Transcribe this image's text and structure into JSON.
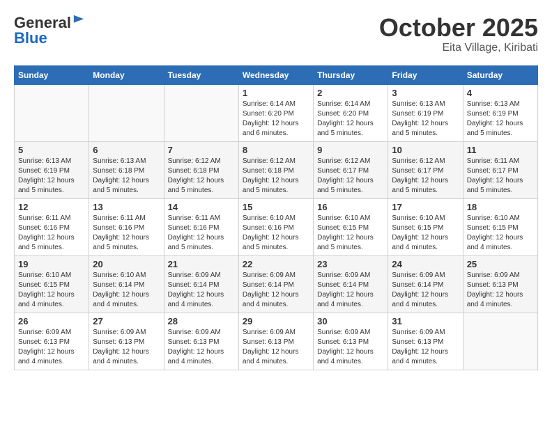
{
  "header": {
    "logo_line1": "General",
    "logo_line2": "Blue",
    "month": "October 2025",
    "location": "Eita Village, Kiribati"
  },
  "weekdays": [
    "Sunday",
    "Monday",
    "Tuesday",
    "Wednesday",
    "Thursday",
    "Friday",
    "Saturday"
  ],
  "weeks": [
    [
      {
        "day": "",
        "info": ""
      },
      {
        "day": "",
        "info": ""
      },
      {
        "day": "",
        "info": ""
      },
      {
        "day": "1",
        "info": "Sunrise: 6:14 AM\nSunset: 6:20 PM\nDaylight: 12 hours\nand 6 minutes."
      },
      {
        "day": "2",
        "info": "Sunrise: 6:14 AM\nSunset: 6:20 PM\nDaylight: 12 hours\nand 5 minutes."
      },
      {
        "day": "3",
        "info": "Sunrise: 6:13 AM\nSunset: 6:19 PM\nDaylight: 12 hours\nand 5 minutes."
      },
      {
        "day": "4",
        "info": "Sunrise: 6:13 AM\nSunset: 6:19 PM\nDaylight: 12 hours\nand 5 minutes."
      }
    ],
    [
      {
        "day": "5",
        "info": "Sunrise: 6:13 AM\nSunset: 6:19 PM\nDaylight: 12 hours\nand 5 minutes."
      },
      {
        "day": "6",
        "info": "Sunrise: 6:13 AM\nSunset: 6:18 PM\nDaylight: 12 hours\nand 5 minutes."
      },
      {
        "day": "7",
        "info": "Sunrise: 6:12 AM\nSunset: 6:18 PM\nDaylight: 12 hours\nand 5 minutes."
      },
      {
        "day": "8",
        "info": "Sunrise: 6:12 AM\nSunset: 6:18 PM\nDaylight: 12 hours\nand 5 minutes."
      },
      {
        "day": "9",
        "info": "Sunrise: 6:12 AM\nSunset: 6:17 PM\nDaylight: 12 hours\nand 5 minutes."
      },
      {
        "day": "10",
        "info": "Sunrise: 6:12 AM\nSunset: 6:17 PM\nDaylight: 12 hours\nand 5 minutes."
      },
      {
        "day": "11",
        "info": "Sunrise: 6:11 AM\nSunset: 6:17 PM\nDaylight: 12 hours\nand 5 minutes."
      }
    ],
    [
      {
        "day": "12",
        "info": "Sunrise: 6:11 AM\nSunset: 6:16 PM\nDaylight: 12 hours\nand 5 minutes."
      },
      {
        "day": "13",
        "info": "Sunrise: 6:11 AM\nSunset: 6:16 PM\nDaylight: 12 hours\nand 5 minutes."
      },
      {
        "day": "14",
        "info": "Sunrise: 6:11 AM\nSunset: 6:16 PM\nDaylight: 12 hours\nand 5 minutes."
      },
      {
        "day": "15",
        "info": "Sunrise: 6:10 AM\nSunset: 6:16 PM\nDaylight: 12 hours\nand 5 minutes."
      },
      {
        "day": "16",
        "info": "Sunrise: 6:10 AM\nSunset: 6:15 PM\nDaylight: 12 hours\nand 5 minutes."
      },
      {
        "day": "17",
        "info": "Sunrise: 6:10 AM\nSunset: 6:15 PM\nDaylight: 12 hours\nand 4 minutes."
      },
      {
        "day": "18",
        "info": "Sunrise: 6:10 AM\nSunset: 6:15 PM\nDaylight: 12 hours\nand 4 minutes."
      }
    ],
    [
      {
        "day": "19",
        "info": "Sunrise: 6:10 AM\nSunset: 6:15 PM\nDaylight: 12 hours\nand 4 minutes."
      },
      {
        "day": "20",
        "info": "Sunrise: 6:10 AM\nSunset: 6:14 PM\nDaylight: 12 hours\nand 4 minutes."
      },
      {
        "day": "21",
        "info": "Sunrise: 6:09 AM\nSunset: 6:14 PM\nDaylight: 12 hours\nand 4 minutes."
      },
      {
        "day": "22",
        "info": "Sunrise: 6:09 AM\nSunset: 6:14 PM\nDaylight: 12 hours\nand 4 minutes."
      },
      {
        "day": "23",
        "info": "Sunrise: 6:09 AM\nSunset: 6:14 PM\nDaylight: 12 hours\nand 4 minutes."
      },
      {
        "day": "24",
        "info": "Sunrise: 6:09 AM\nSunset: 6:14 PM\nDaylight: 12 hours\nand 4 minutes."
      },
      {
        "day": "25",
        "info": "Sunrise: 6:09 AM\nSunset: 6:13 PM\nDaylight: 12 hours\nand 4 minutes."
      }
    ],
    [
      {
        "day": "26",
        "info": "Sunrise: 6:09 AM\nSunset: 6:13 PM\nDaylight: 12 hours\nand 4 minutes."
      },
      {
        "day": "27",
        "info": "Sunrise: 6:09 AM\nSunset: 6:13 PM\nDaylight: 12 hours\nand 4 minutes."
      },
      {
        "day": "28",
        "info": "Sunrise: 6:09 AM\nSunset: 6:13 PM\nDaylight: 12 hours\nand 4 minutes."
      },
      {
        "day": "29",
        "info": "Sunrise: 6:09 AM\nSunset: 6:13 PM\nDaylight: 12 hours\nand 4 minutes."
      },
      {
        "day": "30",
        "info": "Sunrise: 6:09 AM\nSunset: 6:13 PM\nDaylight: 12 hours\nand 4 minutes."
      },
      {
        "day": "31",
        "info": "Sunrise: 6:09 AM\nSunset: 6:13 PM\nDaylight: 12 hours\nand 4 minutes."
      },
      {
        "day": "",
        "info": ""
      }
    ]
  ]
}
